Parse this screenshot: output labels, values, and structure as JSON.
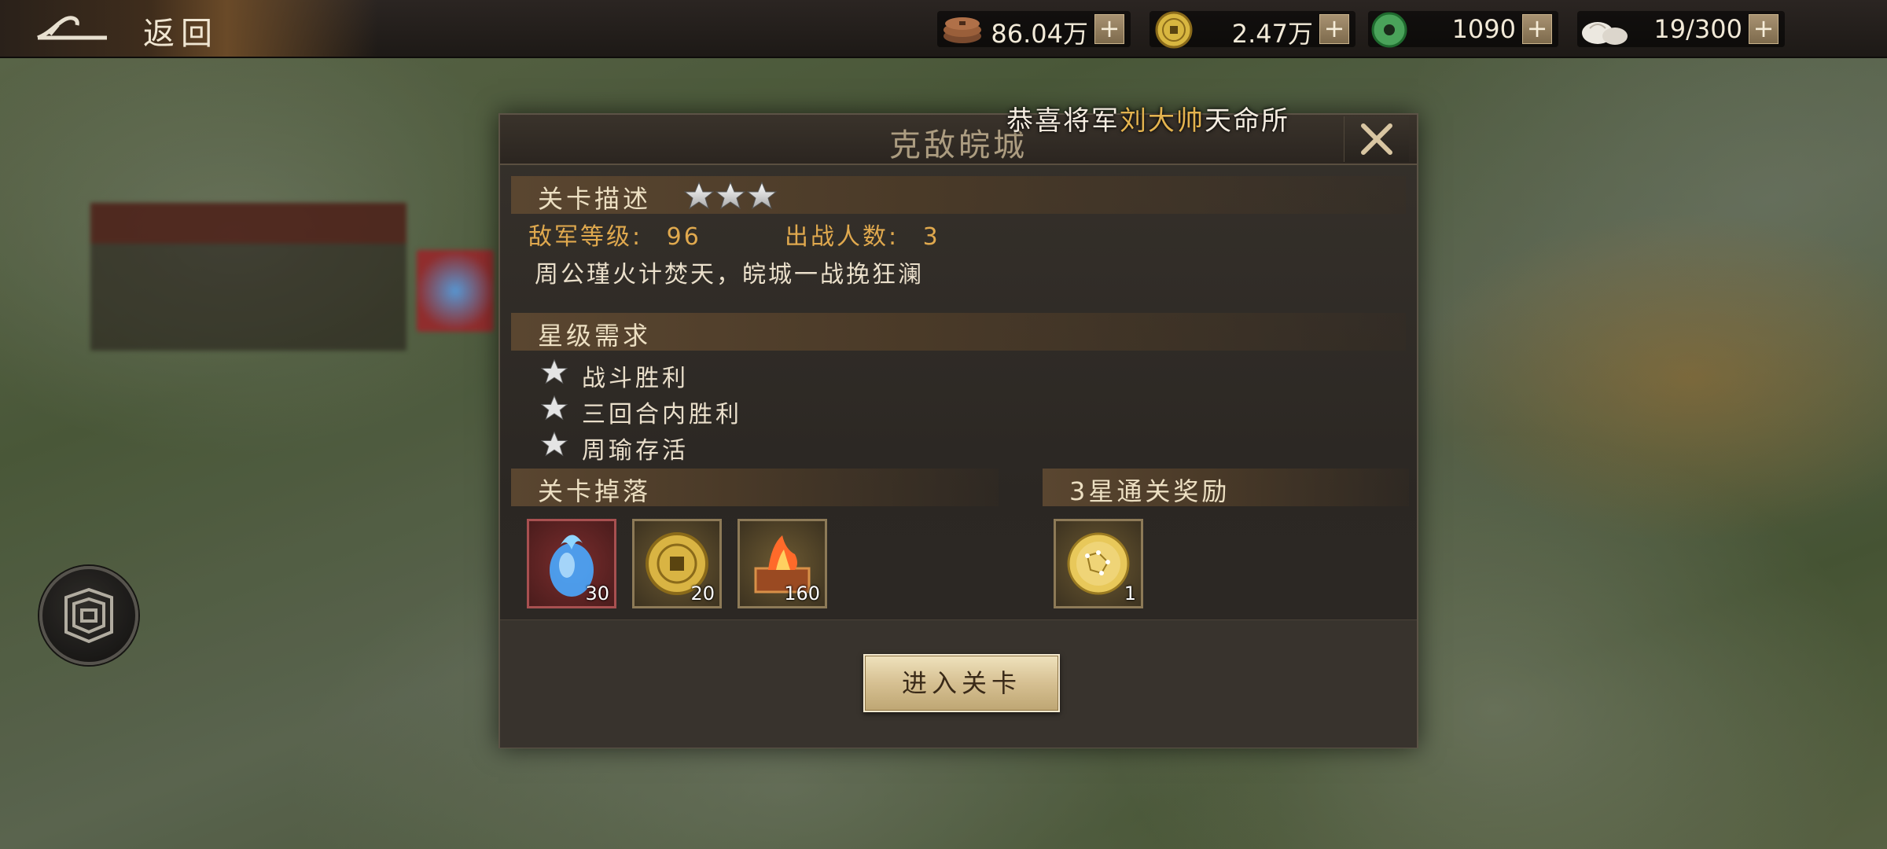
{
  "topbar": {
    "back_label": "返回",
    "resources": [
      {
        "icon": "copper-coins-icon",
        "value": "86.04万"
      },
      {
        "icon": "gold-coin-icon",
        "value": "2.47万"
      },
      {
        "icon": "jade-icon",
        "value": "1090"
      },
      {
        "icon": "steamed-bun-icon",
        "value": "19/300"
      }
    ],
    "plus_label": "+"
  },
  "notice": {
    "prefix": "恭喜将军",
    "name": "刘大帅",
    "suffix": "天命所"
  },
  "modal": {
    "title": "克敌皖城",
    "close_label": "✕",
    "description_section": {
      "label": "关卡描述",
      "stars": 3,
      "enemy_level_label": "敌军等级:",
      "enemy_level": "96",
      "deploy_label": "出战人数:",
      "deploy_count": "3",
      "text": "周公瑾火计焚天，皖城一战挽狂澜"
    },
    "star_requirements": {
      "label": "星级需求",
      "items": [
        "战斗胜利",
        "三回合内胜利",
        "周瑜存活"
      ]
    },
    "drops": {
      "label": "关卡掉落",
      "items": [
        {
          "icon": "blue-flame-crystal-icon",
          "count": "30"
        },
        {
          "icon": "gold-coin-icon",
          "count": "20"
        },
        {
          "icon": "fire-chest-icon",
          "count": "160"
        }
      ]
    },
    "three_star_reward": {
      "label": "3星通关奖励",
      "items": [
        {
          "icon": "golden-orb-icon",
          "count": "1"
        }
      ]
    },
    "enter_button": "进入关卡"
  },
  "colors": {
    "accent_gold": "#e0a94e",
    "highlight_name": "#e3b34f",
    "button_bg": "#d6c092"
  }
}
